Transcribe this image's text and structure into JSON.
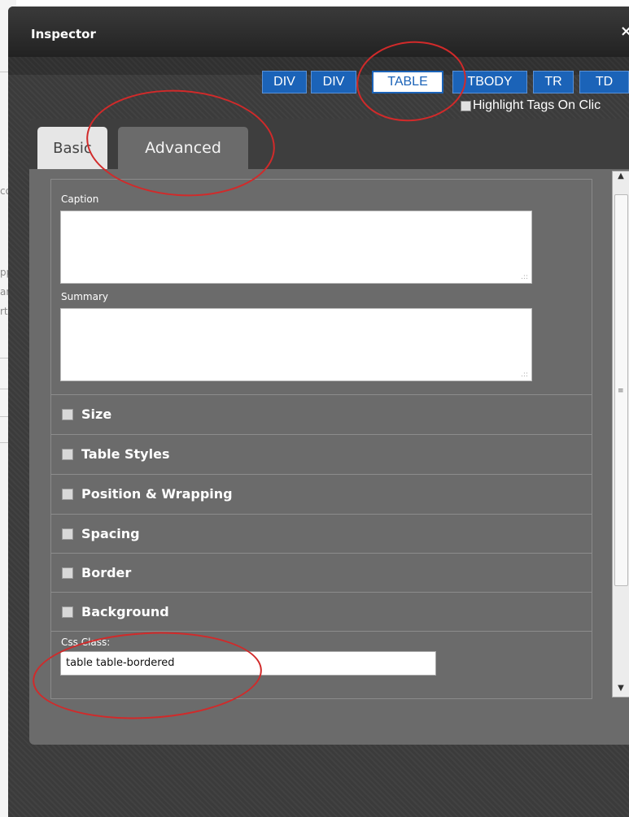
{
  "background_fragments": [
    "co",
    "pp",
    "an",
    "rto"
  ],
  "window": {
    "title": "Inspector",
    "close_glyph": "×"
  },
  "tag_path": [
    "DIV",
    "DIV",
    "TABLE",
    "TBODY",
    "TR",
    "TD"
  ],
  "active_tag": "TABLE",
  "highlight_tags_label": "Highlight Tags On Clic",
  "tabs": {
    "basic": "Basic",
    "advanced": "Advanced"
  },
  "fields": {
    "caption_label": "Caption",
    "summary_label": "Summary"
  },
  "sections": [
    "Size",
    "Table Styles",
    "Position & Wrapping",
    "Spacing",
    "Border",
    "Background"
  ],
  "css_class": {
    "label": "Css Class:",
    "value": "table table-bordered"
  },
  "colors": {
    "annotation": "#d12a2a",
    "tag_button": "#1b63b8",
    "panel": "#6b6b6b"
  },
  "icons": [
    "close-icon",
    "resize-grip-icon",
    "checkbox-icon",
    "scroll-arrow-icon"
  ]
}
